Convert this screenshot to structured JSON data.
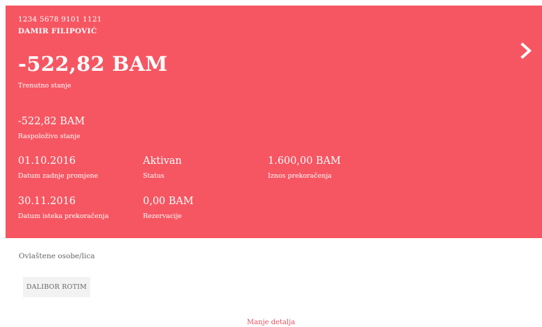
{
  "account": {
    "number": "1234 5678 9101 1121",
    "holder": "DAMIR FILIPOVIĆ",
    "balance": "-522,82 BAM",
    "balance_label": "Trenutno stanje",
    "available": "-522,82 BAM",
    "available_label": "Raspoloživo stanje",
    "last_change_date": "01.10.2016",
    "last_change_label": "Datum zadnje promjene",
    "status": "Aktivan",
    "status_label": "Status",
    "overdraft_amount": "1.600,00 BAM",
    "overdraft_amount_label": "Iznos prekoračenja",
    "overdraft_expiry_date": "30.11.2016",
    "overdraft_expiry_label": "Datum isteka prekoračenja",
    "reservations": "0,00 BAM",
    "reservations_label": "Rezervacije",
    "next_icon": "chevron-right-icon"
  },
  "authorized": {
    "title": "Ovlaštene osobe/lica",
    "persons": [
      "DALIBOR ROTIM"
    ]
  },
  "toggle": {
    "label": "Manje detalja"
  },
  "colors": {
    "card_background": "#f65662",
    "card_text": "#ffffff",
    "link": "#e45160"
  }
}
